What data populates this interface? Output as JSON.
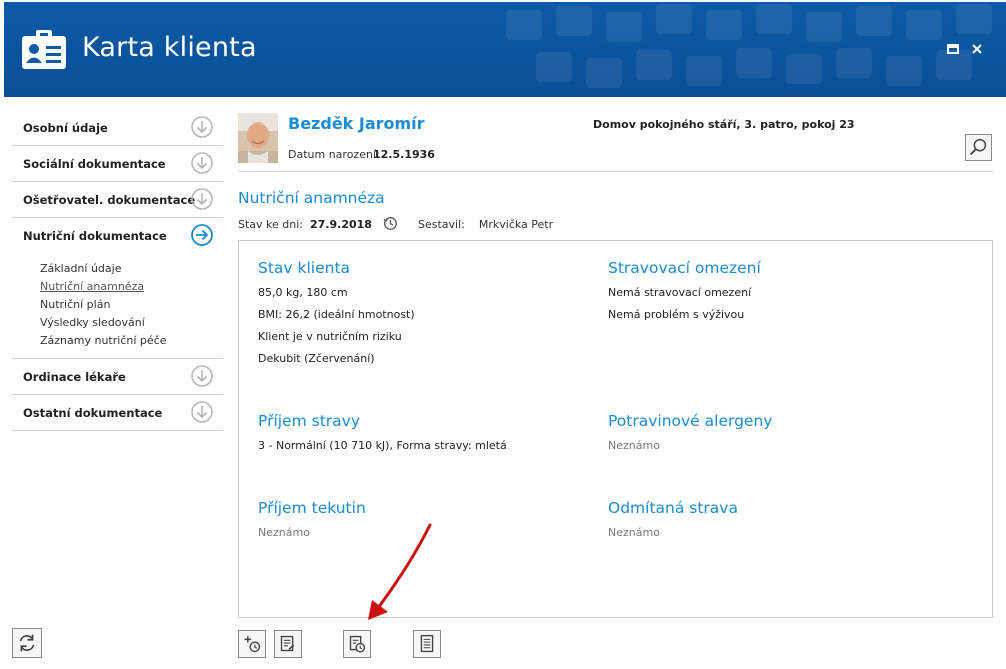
{
  "window": {
    "title": "Karta klienta",
    "colors": {
      "header": "#0d5aa6",
      "accent": "#1a8bd4",
      "annotation": "#cc1111"
    }
  },
  "sidebar": {
    "items": [
      {
        "label": "Osobní údaje",
        "icon": "arrow-down-circle-icon"
      },
      {
        "label": "Sociální dokumentace",
        "icon": "arrow-down-circle-icon"
      },
      {
        "label": "Ošetřovatel. dokumentace",
        "icon": "arrow-down-circle-icon"
      },
      {
        "label": "Nutriční dokumentace",
        "icon": "arrow-right-circle-icon",
        "subitems": [
          "Základní údaje",
          "Nutriční anamnéza",
          "Nutriční plán",
          "Výsledky sledování",
          "Záznamy nutriční péče"
        ],
        "active_subitem": "Nutriční anamnéza"
      },
      {
        "label": "Ordinace lékaře",
        "icon": "arrow-down-circle-icon"
      },
      {
        "label": "Ostatní dokumentace",
        "icon": "arrow-down-circle-icon"
      }
    ]
  },
  "patient": {
    "name": "Bezděk Jaromír",
    "dob_label": "Datum narození:",
    "dob": "12.5.1936",
    "location": "Domov pokojného stáří, 3. patro, pokoj 23"
  },
  "section": {
    "title": "Nutriční anamnéza",
    "date_label": "Stav ke dni:",
    "date": "27.9.2018",
    "author_label": "Sestavil:",
    "author": "Mrkvička Petr"
  },
  "blocks": {
    "stav": {
      "title": "Stav klienta",
      "lines": [
        "85,0 kg, 180 cm",
        "BMI: 26,2 (ideální hmotnost)",
        "Klient je v nutričním riziku",
        "Dekubit (Zčervenání)"
      ]
    },
    "omezeni": {
      "title": "Stravovací omezení",
      "lines": [
        "Nemá stravovací omezení",
        "Nemá problém s výživou"
      ]
    },
    "prijem": {
      "title": "Příjem stravy",
      "lines": [
        "3 - Normální (10 710 kJ), Forma stravy: mletá"
      ]
    },
    "alergeny": {
      "title": "Potravinové alergeny",
      "lines": [
        "Neznámo"
      ]
    },
    "tekutiny": {
      "title": "Příjem tekutin",
      "lines": [
        "Neznámo"
      ]
    },
    "odmitana": {
      "title": "Odmítaná strava",
      "lines": [
        "Neznámo"
      ]
    }
  }
}
